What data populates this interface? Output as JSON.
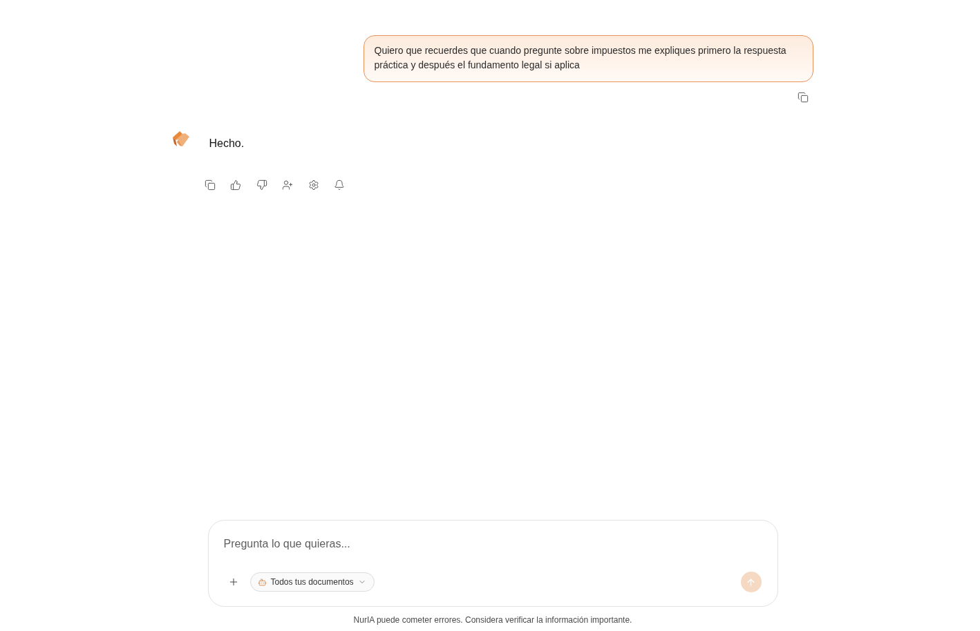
{
  "messages": [
    {
      "kind": "user",
      "text": "Quiero que recuerdes que cuando pregunte sobre impuestos me expliques primero la respuesta práctica y después el fundamento legal si aplica"
    },
    {
      "kind": "assistant",
      "text": "Hecho."
    }
  ],
  "composer": {
    "placeholder": "Pregunta lo que quieras...",
    "source_selector": {
      "label": "Todos tus documentos"
    },
    "send_button": {
      "disabled": true
    }
  },
  "disclaimer": "NurIA puede cometer errores. Considera verificar la información importante."
}
